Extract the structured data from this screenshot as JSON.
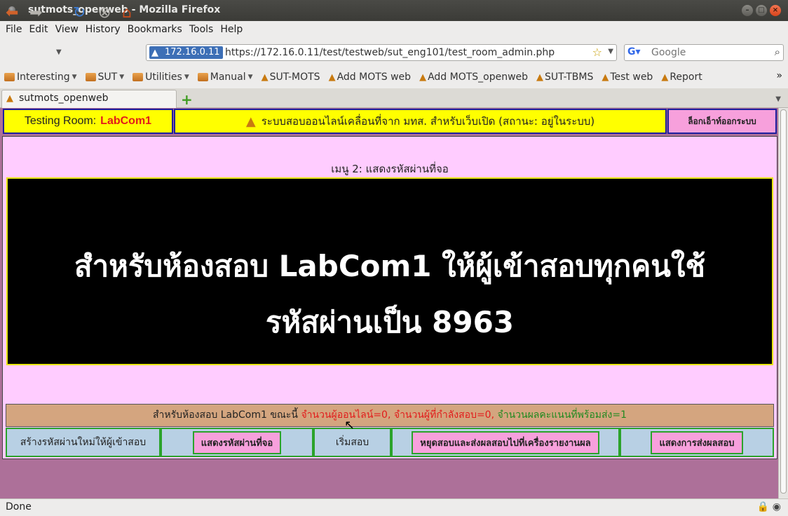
{
  "window": {
    "title": "sutmots_openweb - Mozilla Firefox"
  },
  "menubar": [
    "File",
    "Edit",
    "View",
    "History",
    "Bookmarks",
    "Tools",
    "Help"
  ],
  "urlbar": {
    "site": "172.16.0.11",
    "url": "https://172.16.0.11/test/testweb/sut_eng101/test_room_admin.php"
  },
  "search": {
    "placeholder": "Google"
  },
  "bookmarks": [
    {
      "label": "Interesting",
      "folder": true
    },
    {
      "label": "SUT",
      "folder": true
    },
    {
      "label": "Utilities",
      "folder": true
    },
    {
      "label": "Manual",
      "folder": true
    },
    {
      "label": "SUT-MOTS",
      "folder": false
    },
    {
      "label": "Add MOTS web",
      "folder": false
    },
    {
      "label": "Add MOTS_openweb",
      "folder": false
    },
    {
      "label": "SUT-TBMS",
      "folder": false
    },
    {
      "label": "Test web",
      "folder": false
    },
    {
      "label": "Report",
      "folder": false
    }
  ],
  "tab": {
    "title": "sutmots_openweb"
  },
  "header": {
    "room_label": "Testing  Room:",
    "room_value": "LabCom1",
    "system_text": "ระบบสอบออนไลน์เคลื่อนที่จาก มทส. สำหรับเว็บเปิด (สถานะ: อยู่ในระบบ)",
    "logout": "ล็อกเอ็าท์ออกระบบ"
  },
  "main": {
    "menu_title": "เมนู 2:  แสดงรหัสผ่านที่จอ",
    "line1": "สำหรับห้องสอบ LabCom1 ให้ผู้เข้าสอบทุกคนใช้",
    "line2": "รหัสผ่านเป็น 8963"
  },
  "status": {
    "prefix": "สำหรับห้องสอบ  LabCom1  ขณะนี้",
    "online": "จำนวนผู้ออนไลน์=0,",
    "testing": "จำนวนผู้ที่กำลังสอบ=0,",
    "scores": "จำนวนผลคะแนนที่พร้อมส่ง=1"
  },
  "actions": {
    "create_password": "สร้างรหัสผ่านใหม่ให้ผู้เข้าสอบ",
    "show_password": "แสดงรหัสผ่านที่จอ",
    "start_exam": "เริ่มสอบ",
    "stop_and_send": "หยุดสอบและส่งผลสอบไปที่เครื่องรายงานผล",
    "show_sent": "แสดงการส่งผลสอบ"
  },
  "statusbar": {
    "text": "Done"
  },
  "colors": {
    "yellow": "#ffff00",
    "red": "#e21b1b",
    "green": "#208a20",
    "pink": "#ffccff",
    "button_pink": "#f7a0dc"
  }
}
